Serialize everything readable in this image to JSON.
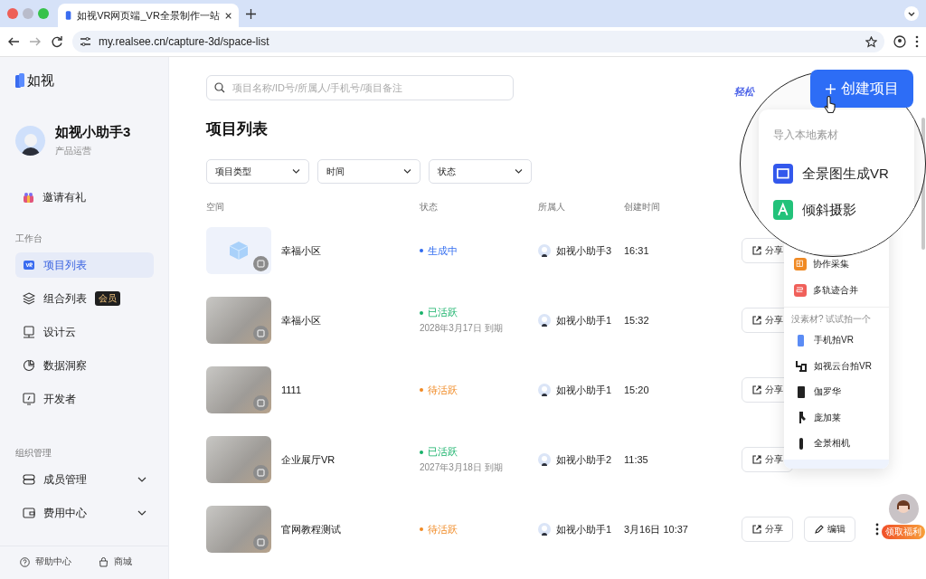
{
  "browser": {
    "tab_title": "如视VR网页端_VR全景制作一站",
    "url": "my.realsee.cn/capture-3d/space-list"
  },
  "sidebar": {
    "logo": "如视",
    "user": {
      "name": "如视小助手3",
      "role": "产品运营"
    },
    "invite": "邀请有礼",
    "sections": [
      {
        "title": "工作台",
        "items": [
          {
            "label": "项目列表",
            "selected": true
          },
          {
            "label": "组合列表",
            "badge": "会员",
            "selected": false
          },
          {
            "label": "设计云",
            "selected": false
          },
          {
            "label": "数据洞察",
            "selected": false
          },
          {
            "label": "开发者",
            "selected": false
          }
        ]
      },
      {
        "title": "组织管理",
        "items": [
          {
            "label": "成员管理",
            "selected": false,
            "expanded": false
          },
          {
            "label": "费用中心",
            "selected": false,
            "expanded": false
          }
        ]
      }
    ],
    "footer": [
      "帮助中心",
      "商城"
    ]
  },
  "main": {
    "search": {
      "placeholder": "项目名称/ID号/所属人/手机号/项目备注"
    },
    "promo_link": "轻松",
    "title": "项目列表",
    "filters": [
      "项目类型",
      "时间",
      "状态"
    ],
    "columns": [
      "空间",
      "状态",
      "所属人",
      "创建时间"
    ],
    "rows": [
      {
        "kind": "model",
        "name": "幸福小区",
        "status": {
          "kind": "generating",
          "label": "生成中"
        },
        "owner": "如视小助手3",
        "created": "16:31",
        "share": "分享"
      },
      {
        "kind": "photo",
        "name": "幸福小区",
        "status": {
          "kind": "active",
          "label": "已活跃",
          "expiry": "2028年3月17日 到期"
        },
        "owner": "如视小助手1",
        "created": "15:32",
        "share": "分享"
      },
      {
        "kind": "photo",
        "name": "1111",
        "status": {
          "kind": "pending",
          "label": "待活跃"
        },
        "owner": "如视小助手1",
        "created": "15:20",
        "share": "分享"
      },
      {
        "kind": "photo",
        "name": "企业展厅VR",
        "status": {
          "kind": "active",
          "label": "已活跃",
          "expiry": "2027年3月18日 到期"
        },
        "owner": "如视小助手2",
        "created": "11:35",
        "share": "分享"
      },
      {
        "kind": "photo",
        "name": "官网教程测试",
        "status": {
          "kind": "pending",
          "label": "待活跃"
        },
        "owner": "如视小助手1",
        "created": "3月16日 10:37",
        "share": "分享",
        "edit": "编辑"
      }
    ]
  },
  "create_menu": {
    "button": "创建项目",
    "magnified_heading": "导入本地素材",
    "magnified_items": [
      {
        "kind": "panorama",
        "label": "全景图生成VR"
      },
      {
        "kind": "oblique",
        "label": "倾斜摄影"
      }
    ],
    "items": [
      {
        "kind": "collab",
        "label": "协作采集"
      },
      {
        "kind": "merge",
        "label": "多轨迹合并"
      }
    ],
    "capture_heading": "没素材? 试试拍一个",
    "capture_items": [
      {
        "kind": "phone",
        "label": "手机拍VR"
      },
      {
        "kind": "gimbal",
        "label": "如视云台拍VR"
      },
      {
        "kind": "galois",
        "label": "伽罗华"
      },
      {
        "kind": "poincare",
        "label": "庞加莱"
      },
      {
        "kind": "camera",
        "label": "全景相机"
      }
    ]
  },
  "assistant": {
    "badge": "领取福利"
  }
}
